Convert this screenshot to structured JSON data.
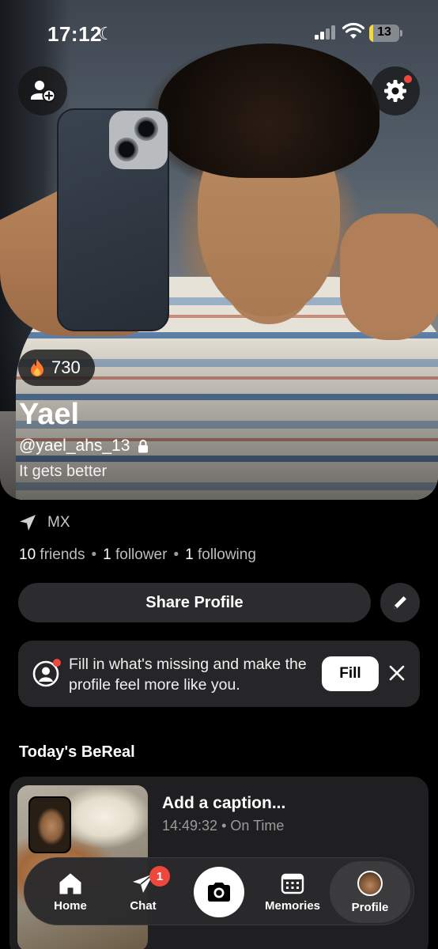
{
  "status_bar": {
    "time": "17:12",
    "battery": "13",
    "battery_color": "#f5d742"
  },
  "hero": {
    "streak_count": "730",
    "name": "Yael",
    "username": "@yael_ahs_13",
    "bio": "It gets better"
  },
  "profile_info": {
    "location": "MX",
    "stats": [
      {
        "count": "10",
        "label": "friends"
      },
      {
        "count": "1",
        "label": "follower"
      },
      {
        "count": "1",
        "label": "following"
      }
    ],
    "separator": "•"
  },
  "actions": {
    "share_label": "Share Profile"
  },
  "fill_prompt": {
    "text": "Fill in what's missing and make the profile feel more like you.",
    "button_label": "Fill"
  },
  "todays_bereal": {
    "section_title": "Today's BeReal",
    "caption_placeholder": "Add a caption...",
    "time": "14:49:32",
    "separator": "•",
    "timing": "On Time"
  },
  "nav": {
    "items": [
      {
        "label": "Home",
        "icon": "home-icon"
      },
      {
        "label": "Chat",
        "icon": "paper-plane-icon",
        "badge": "1"
      },
      {
        "label": "",
        "icon": "camera-icon"
      },
      {
        "label": "Memories",
        "icon": "calendar-icon"
      },
      {
        "label": "Profile",
        "icon": "avatar"
      }
    ]
  },
  "colors": {
    "accent_red": "#f0473d",
    "streak_flame": "#ff7a2f",
    "card_bg": "#2c2c2e"
  }
}
